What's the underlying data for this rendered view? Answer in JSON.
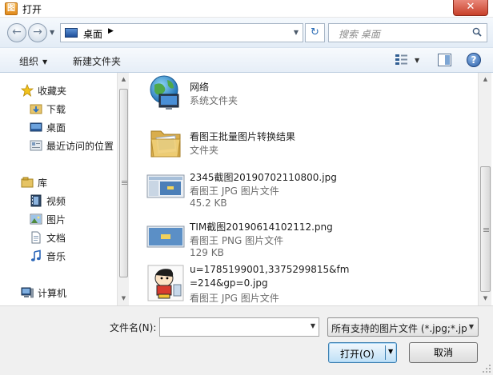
{
  "window": {
    "title": "打开",
    "app_icon_glyph": "图",
    "close_glyph": "✕"
  },
  "nav": {
    "back_glyph": "←",
    "forward_glyph": "→",
    "dropdown_glyph": "▼"
  },
  "address": {
    "location": "桌面",
    "arrow": "▶",
    "dropdown_glyph": "▼",
    "refresh_glyph": "↻"
  },
  "search": {
    "placeholder": "搜索 桌面"
  },
  "toolbar": {
    "organize_label": "组织",
    "organize_caret": "▼",
    "new_folder_label": "新建文件夹",
    "view_caret": "▼",
    "help_glyph": "?"
  },
  "sidebar": {
    "favorites_header": "收藏夹",
    "favorites": [
      "下载",
      "桌面",
      "最近访问的位置"
    ],
    "libraries_header": "库",
    "libraries": [
      "视频",
      "图片",
      "文档",
      "音乐"
    ],
    "computer_header": "计算机"
  },
  "files": [
    {
      "name": "网络",
      "type": "系统文件夹",
      "size": ""
    },
    {
      "name": "看图王批量图片转换结果",
      "type": "文件夹",
      "size": ""
    },
    {
      "name": "2345截图20190702110800.jpg",
      "type": "看图王 JPG 图片文件",
      "size": "45.2 KB"
    },
    {
      "name": "TIM截图20190614102112.png",
      "type": "看图王 PNG 图片文件",
      "size": "129 KB"
    },
    {
      "name_line1": "u=1785199001,3375299815&fm",
      "name_line2": "=214&gp=0.jpg",
      "type": "看图王 JPG 图片文件"
    }
  ],
  "bottom": {
    "filename_label": "文件名(N):",
    "filename_value": "",
    "filename_drop": "▼",
    "filetype_value": "所有支持的图片文件 (*.jpg;*.jp",
    "filetype_drop": "▼",
    "open_label": "打开(O)",
    "open_drop": "▼",
    "cancel_label": "取消"
  },
  "scroll": {
    "up_glyph": "▲",
    "down_glyph": "▼"
  },
  "colors": {
    "accent": "#3c7fb1",
    "toolbar_bg": "#e6eef7",
    "close_red": "#c8402a"
  }
}
